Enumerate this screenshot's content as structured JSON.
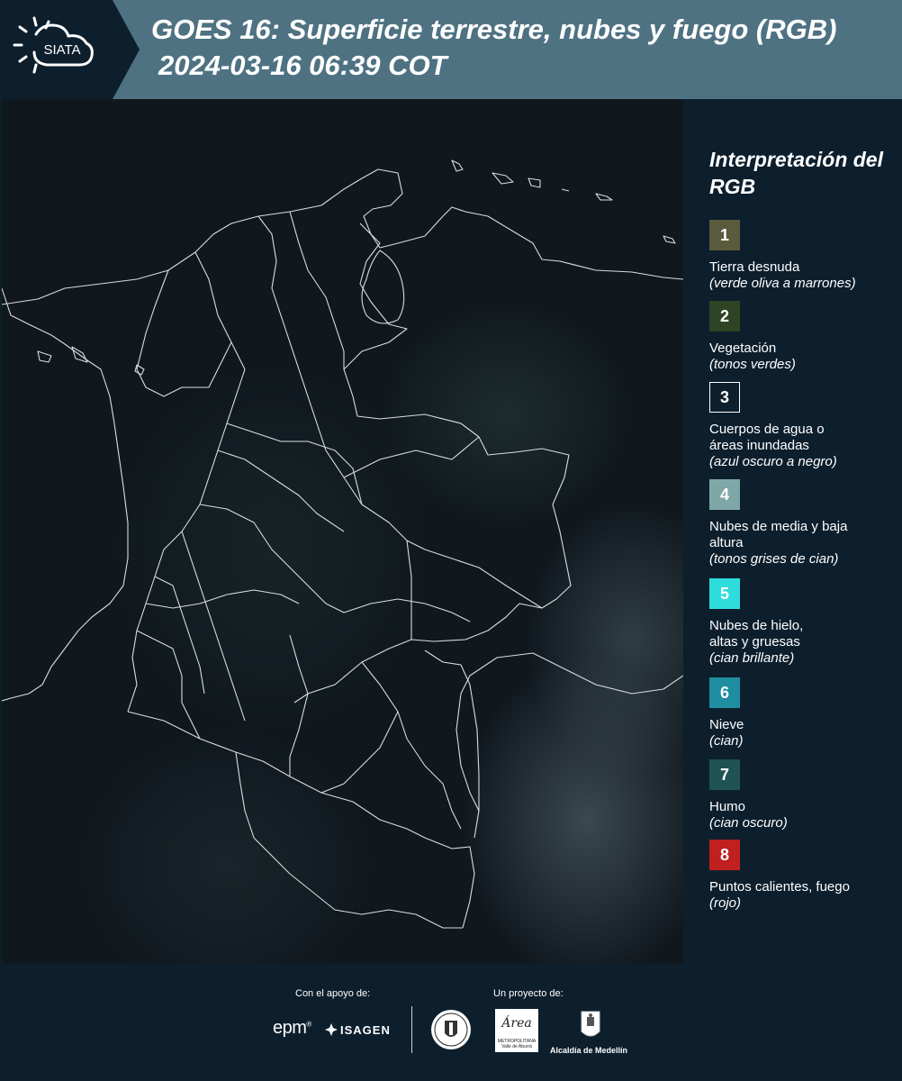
{
  "header": {
    "logo_text": "SIATA",
    "title": "GOES 16: Superficie terrestre, nubes y fuego (RGB)",
    "subtitle": "2024-03-16 06:39 COT"
  },
  "legend": {
    "title": "Interpretación del RGB",
    "items": [
      {
        "number": "1",
        "label": "Tierra desnuda",
        "note": "(verde oliva a marrones)",
        "color": "#5a5a3c"
      },
      {
        "number": "2",
        "label": "Vegetación",
        "note": "(tonos verdes)",
        "color": "#2f4424"
      },
      {
        "number": "3",
        "label": "Cuerpos de agua o áreas inundadas",
        "note": "(azul oscuro a negro)",
        "color": "#0d1f2d"
      },
      {
        "number": "4",
        "label": "Nubes de media y baja altura",
        "note": "(tonos grises de cian)",
        "color": "#7fa7a7"
      },
      {
        "number": "5",
        "label": "Nubes de hielo, altas y gruesas",
        "note": "(cian brillante)",
        "color": "#2fdcdc"
      },
      {
        "number": "6",
        "label": "Nieve",
        "note": "(cian)",
        "color": "#1f8ea0"
      },
      {
        "number": "7",
        "label": "Humo",
        "note": "(cian oscuro)",
        "color": "#1f5254"
      },
      {
        "number": "8",
        "label": "Puntos calientes, fuego",
        "note": "(rojo)",
        "color": "#c02020"
      }
    ]
  },
  "footer": {
    "support_label": "Con el apoyo de:",
    "project_label": "Un proyecto de:",
    "sponsors": {
      "epm": "epm",
      "isagen": "ISAGEN",
      "area_logo": "Área",
      "area_sub": "METROPOLITANA Valle de Aburrá",
      "alcaldia": "Alcaldía de Medellín"
    }
  }
}
